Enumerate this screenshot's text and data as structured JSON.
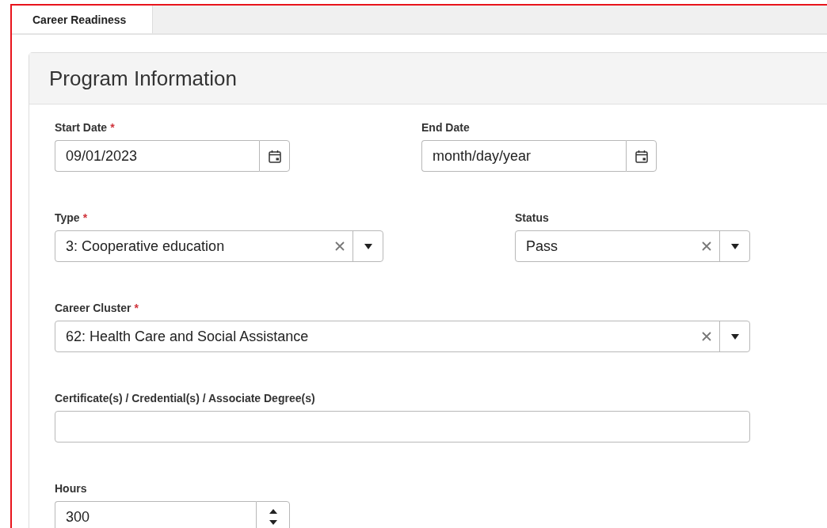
{
  "tabs": [
    {
      "label": "Career Readiness",
      "selected": true
    }
  ],
  "section": {
    "title": "Program Information",
    "rows": [
      [
        {
          "kind": "date",
          "label": "Start Date",
          "required_mark": "*",
          "value": "09/01/2023"
        },
        {
          "kind": "date",
          "label": "End Date",
          "placeholder": "month/day/year"
        }
      ],
      [
        {
          "kind": "select",
          "label": "Type",
          "required_mark": "*",
          "value": "3: Cooperative education"
        },
        {
          "kind": "select",
          "label": "Status",
          "value": "Pass"
        }
      ],
      [
        {
          "kind": "select",
          "label": "Career Cluster",
          "required_mark": "*",
          "value": "62: Health Care and Social Assistance",
          "wide": true
        }
      ],
      [
        {
          "kind": "text",
          "label": "Certificate(s) / Credential(s) / Associate Degree(s)",
          "wide": true
        }
      ],
      [
        {
          "kind": "number",
          "label": "Hours",
          "value": "300"
        }
      ]
    ]
  }
}
